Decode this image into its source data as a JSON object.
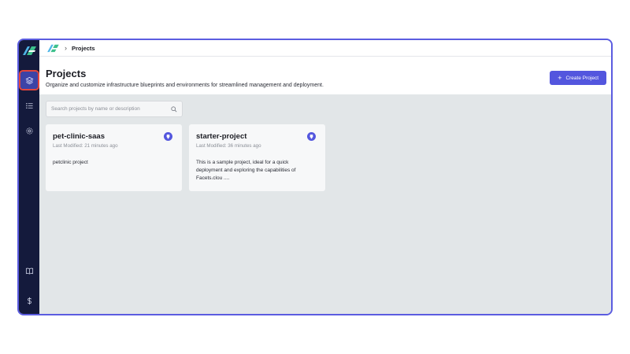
{
  "breadcrumb": {
    "separator": "›",
    "current": "Projects"
  },
  "header": {
    "title": "Projects",
    "subtitle": "Organize and customize infrastructure blueprints and environments for streamlined management and deployment.",
    "create_button": {
      "icon": "plus-icon",
      "label": "Create Project"
    }
  },
  "search": {
    "placeholder": "Search projects by name or description",
    "value": "",
    "icon": "search-icon"
  },
  "sidebar": {
    "items": [
      {
        "name": "projects",
        "icon": "layers-icon",
        "active": true
      },
      {
        "name": "list",
        "icon": "list-icon",
        "active": false
      },
      {
        "name": "settings",
        "icon": "gear-icon",
        "active": false
      }
    ],
    "bottom_items": [
      {
        "name": "docs",
        "icon": "book-icon"
      },
      {
        "name": "billing",
        "icon": "dollar-icon"
      }
    ]
  },
  "projects": [
    {
      "title": "pet-clinic-saas",
      "modified": "Last Modified: 21 minutes ago",
      "description": "petclinic project",
      "badge_icon": "github-icon"
    },
    {
      "title": "starter-project",
      "modified": "Last Modified: 36 minutes ago",
      "description": "This is a sample project, ideal for a quick deployment and exploring the capabilities of Facets.clou ....",
      "badge_icon": "github-icon"
    }
  ],
  "colors": {
    "sidebar_bg": "#141a3c",
    "accent": "#5356de",
    "frame_border": "#5b5ce0",
    "active_outline": "#e2463c",
    "content_bg": "#e2e6e8"
  }
}
